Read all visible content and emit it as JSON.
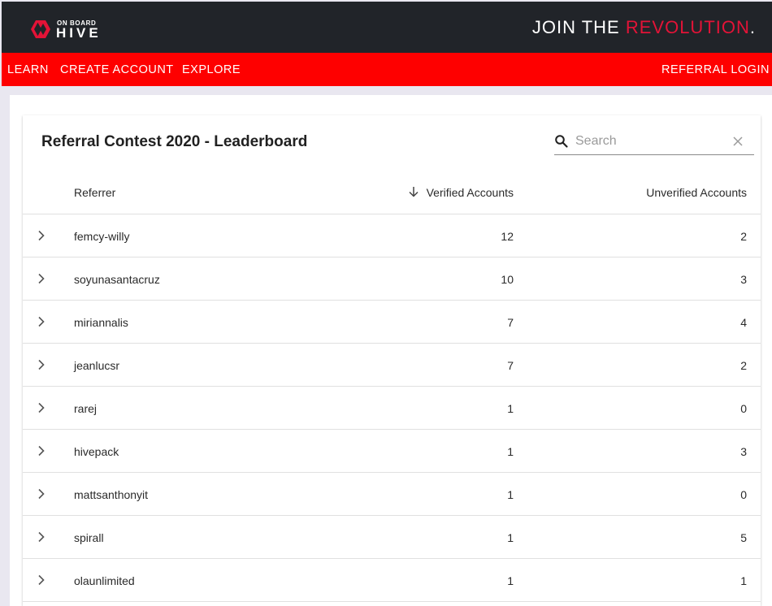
{
  "brand": {
    "logo_small": "ON BOARD",
    "logo_big": "HIVE",
    "tagline_plain": "JOIN THE ",
    "tagline_accent": "REVOLUTION",
    "tagline_dot": ".",
    "accent_color": "#e31337",
    "nav_color": "#fe0000"
  },
  "nav": {
    "learn": "LEARN",
    "create_account": "CREATE ACCOUNT",
    "explore": "EXPLORE",
    "referral_login": "REFERRAL LOGIN"
  },
  "leaderboard": {
    "title": "Referral Contest 2020 - Leaderboard",
    "search_placeholder": "Search",
    "columns": {
      "referrer": "Referrer",
      "verified": "Verified Accounts",
      "unverified": "Unverified Accounts"
    },
    "sort": {
      "column": "verified",
      "direction": "descending",
      "icon": "arrow-down-icon"
    },
    "rows": [
      {
        "referrer": "femcy-willy",
        "verified": "12",
        "unverified": "2"
      },
      {
        "referrer": "soyunasantacruz",
        "verified": "10",
        "unverified": "3"
      },
      {
        "referrer": "miriannalis",
        "verified": "7",
        "unverified": "4"
      },
      {
        "referrer": "jeanlucsr",
        "verified": "7",
        "unverified": "2"
      },
      {
        "referrer": "rarej",
        "verified": "1",
        "unverified": "0"
      },
      {
        "referrer": "hivepack",
        "verified": "1",
        "unverified": "3"
      },
      {
        "referrer": "mattsanthonyit",
        "verified": "1",
        "unverified": "0"
      },
      {
        "referrer": "spirall",
        "verified": "1",
        "unverified": "5"
      },
      {
        "referrer": "olaunlimited",
        "verified": "1",
        "unverified": "1"
      }
    ]
  }
}
